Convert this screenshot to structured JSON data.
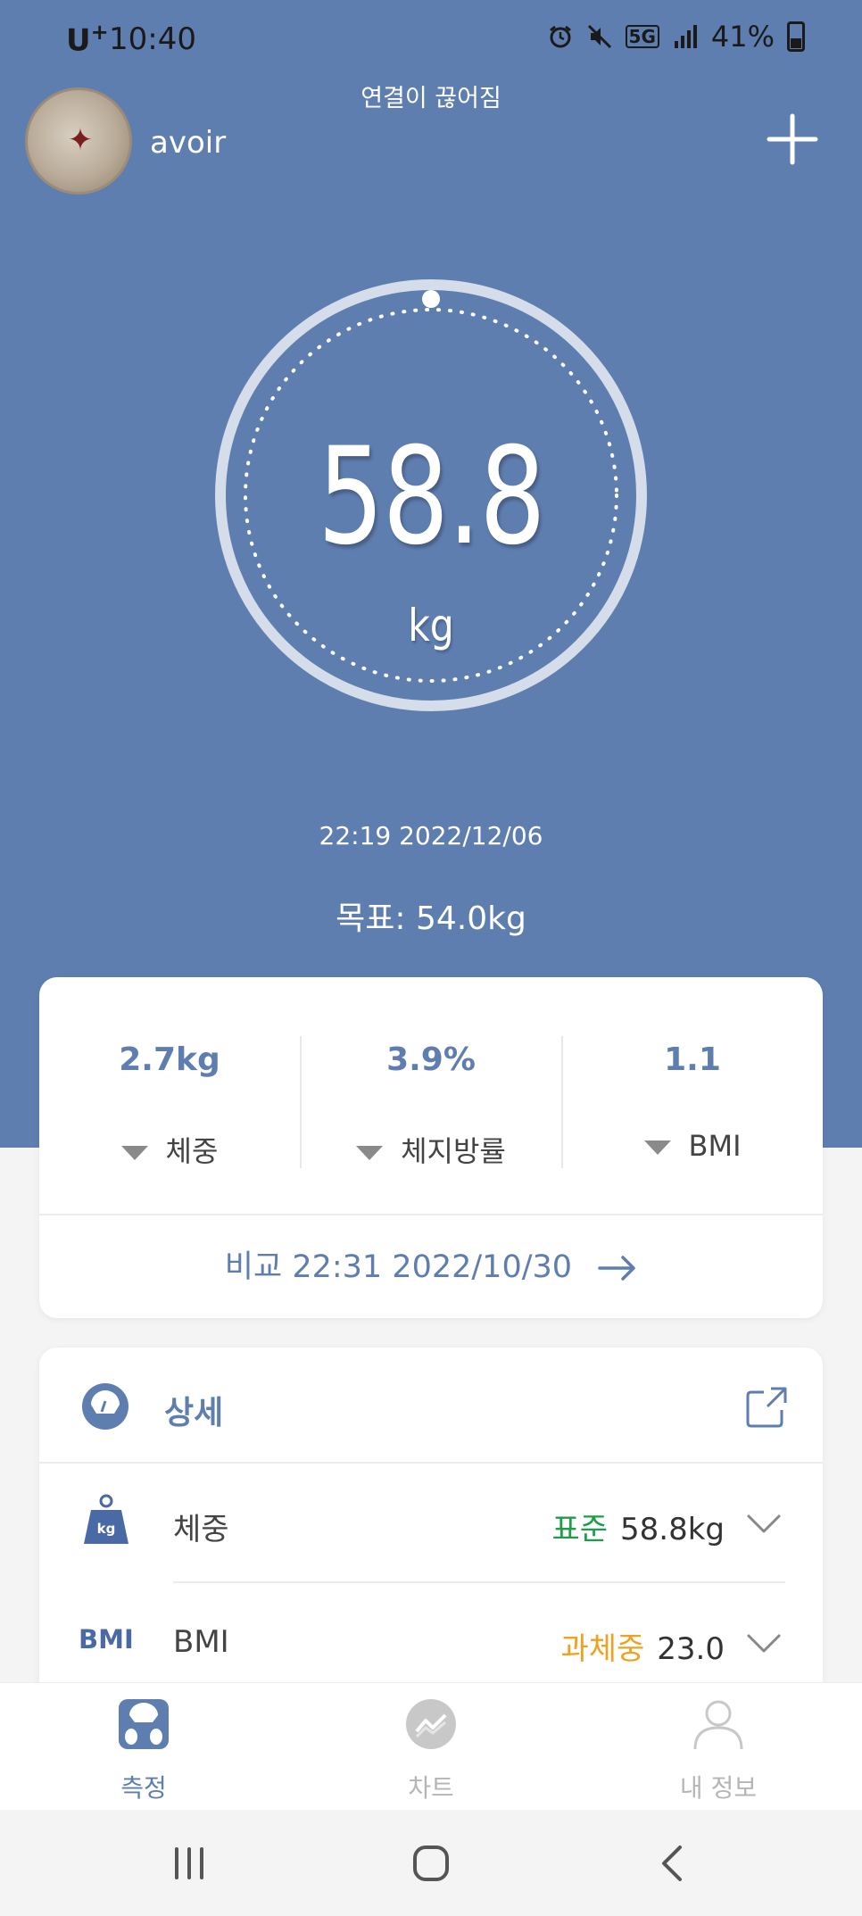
{
  "status_bar": {
    "carrier": "U",
    "carrier_sup": "+",
    "time": "10:40",
    "network": "5G",
    "battery": "41%"
  },
  "header": {
    "connection_status": "연결이 끊어짐",
    "username": "avoir"
  },
  "gauge": {
    "value": "58.8",
    "unit": "kg"
  },
  "measurement": {
    "datetime": "22:19 2022/12/06",
    "goal": "목표: 54.0kg"
  },
  "comparison": {
    "stats": [
      {
        "value": "2.7kg",
        "label": "체중"
      },
      {
        "value": "3.9%",
        "label": "체지방률"
      },
      {
        "value": "1.1",
        "label": "BMI"
      }
    ],
    "link_label": "비교 22:31 2022/10/30"
  },
  "details": {
    "title": "상세",
    "rows": [
      {
        "icon": "weight-icon",
        "badge": "kg",
        "label": "체중",
        "status": "표준",
        "status_color": "#1f9e4a",
        "value": "58.8kg"
      },
      {
        "icon": "bmi-icon",
        "badge": "BMI",
        "label": "BMI",
        "status": "과체중",
        "status_color": "#eea21f",
        "value": "23.0"
      }
    ]
  },
  "bottom_nav": {
    "items": [
      {
        "label": "측정",
        "active": true
      },
      {
        "label": "차트",
        "active": false
      },
      {
        "label": "내 정보",
        "active": false
      }
    ]
  },
  "colors": {
    "primary": "#5f7eb0",
    "standard": "#1f9e4a",
    "overweight": "#eea21f"
  }
}
